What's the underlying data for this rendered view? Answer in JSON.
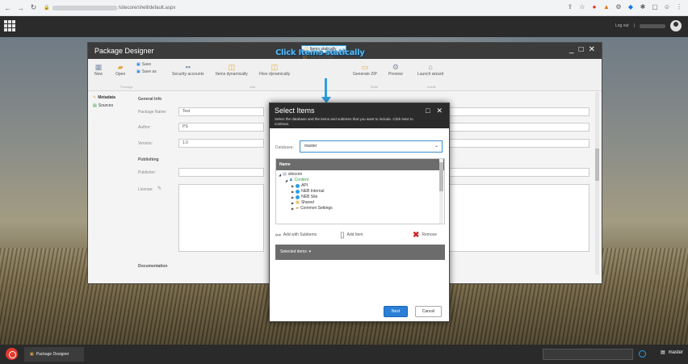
{
  "browser": {
    "url": "/sitecore/shell/default.aspx"
  },
  "sitecore_bar": {
    "logout_label": "Log out",
    "separator": "|"
  },
  "annotation": {
    "text": "Click Items statically",
    "color": "#5ab8f0"
  },
  "package_designer": {
    "title": "Package Designer",
    "ribbon": {
      "new_label": "New",
      "open_label": "Open",
      "save_label": "Save",
      "save_as_label": "Save as",
      "security_accounts_label": "Security accounts",
      "items_dynamically_label": "Items dynamically",
      "files_dynamically_label": "Files dynamically",
      "items_statically_label": "Items statically",
      "files_statically_label": "Files statically",
      "generate_zip_label": "Generate ZIP",
      "preview_label": "Preview",
      "launch_wizard_label": "Launch wizard",
      "group_package": "Package",
      "group_add": "Add",
      "group_build": "Build",
      "group_install": "Install"
    },
    "left_nav": {
      "metadata_label": "Metadata",
      "sources_label": "Sources"
    },
    "general_info": {
      "section_title": "General Info",
      "package_name_label": "Package Name:",
      "package_name_value": "Test",
      "author_label": "Author:",
      "author_value": "PS",
      "version_label": "Version:",
      "version_value": "1.0"
    },
    "publishing": {
      "section_title": "Publishing",
      "publisher_label": "Publisher:",
      "license_label": "License:"
    },
    "documentation_title": "Documentation"
  },
  "dialog": {
    "title": "Select Items",
    "description": "Select the database and the items and subtrees that you want to include. Click Next to continue.",
    "database_label": "Database:",
    "database_value": "master",
    "tree_header": "Name",
    "tree": [
      {
        "label": "sitecore",
        "level": 0,
        "icon": "page-icon",
        "expanded": true
      },
      {
        "label": "Content",
        "level": 1,
        "icon": "content-icon",
        "expanded": true,
        "color": "#2e9b3a"
      },
      {
        "label": "API",
        "level": 2,
        "icon": "globe-icon"
      },
      {
        "label": "NEB Internal",
        "level": 2,
        "icon": "globe-icon"
      },
      {
        "label": "NEB Site",
        "level": 2,
        "icon": "globe-icon"
      },
      {
        "label": "Shared",
        "level": 2,
        "icon": "shared-icon"
      },
      {
        "label": "Common Settings",
        "level": 2,
        "icon": "folder-icon"
      }
    ],
    "add_with_subitems_label": "Add with Subitems",
    "add_item_label": "Add Item",
    "remove_label": "Remove",
    "selected_items_label": "Selected items: ▾",
    "next_label": "Next",
    "cancel_label": "Cancel",
    "next_color": "#2b7fd6"
  },
  "taskbar": {
    "app_label": "Package Designer",
    "database_label": "master"
  }
}
